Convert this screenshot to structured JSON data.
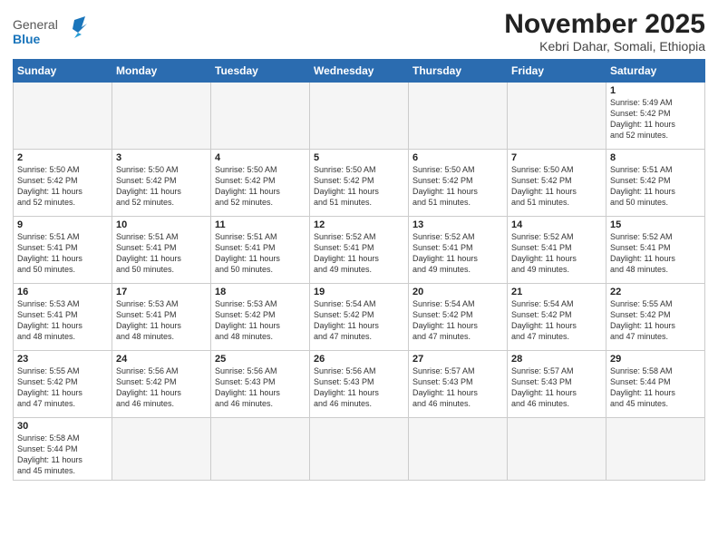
{
  "header": {
    "logo_line1": "General",
    "logo_line2": "Blue",
    "month": "November 2025",
    "location": "Kebri Dahar, Somali, Ethiopia"
  },
  "weekdays": [
    "Sunday",
    "Monday",
    "Tuesday",
    "Wednesday",
    "Thursday",
    "Friday",
    "Saturday"
  ],
  "weeks": [
    [
      {
        "day": "",
        "info": ""
      },
      {
        "day": "",
        "info": ""
      },
      {
        "day": "",
        "info": ""
      },
      {
        "day": "",
        "info": ""
      },
      {
        "day": "",
        "info": ""
      },
      {
        "day": "",
        "info": ""
      },
      {
        "day": "1",
        "info": "Sunrise: 5:49 AM\nSunset: 5:42 PM\nDaylight: 11 hours\nand 52 minutes."
      }
    ],
    [
      {
        "day": "2",
        "info": "Sunrise: 5:50 AM\nSunset: 5:42 PM\nDaylight: 11 hours\nand 52 minutes."
      },
      {
        "day": "3",
        "info": "Sunrise: 5:50 AM\nSunset: 5:42 PM\nDaylight: 11 hours\nand 52 minutes."
      },
      {
        "day": "4",
        "info": "Sunrise: 5:50 AM\nSunset: 5:42 PM\nDaylight: 11 hours\nand 52 minutes."
      },
      {
        "day": "5",
        "info": "Sunrise: 5:50 AM\nSunset: 5:42 PM\nDaylight: 11 hours\nand 51 minutes."
      },
      {
        "day": "6",
        "info": "Sunrise: 5:50 AM\nSunset: 5:42 PM\nDaylight: 11 hours\nand 51 minutes."
      },
      {
        "day": "7",
        "info": "Sunrise: 5:50 AM\nSunset: 5:42 PM\nDaylight: 11 hours\nand 51 minutes."
      },
      {
        "day": "8",
        "info": "Sunrise: 5:51 AM\nSunset: 5:42 PM\nDaylight: 11 hours\nand 50 minutes."
      }
    ],
    [
      {
        "day": "9",
        "info": "Sunrise: 5:51 AM\nSunset: 5:41 PM\nDaylight: 11 hours\nand 50 minutes."
      },
      {
        "day": "10",
        "info": "Sunrise: 5:51 AM\nSunset: 5:41 PM\nDaylight: 11 hours\nand 50 minutes."
      },
      {
        "day": "11",
        "info": "Sunrise: 5:51 AM\nSunset: 5:41 PM\nDaylight: 11 hours\nand 50 minutes."
      },
      {
        "day": "12",
        "info": "Sunrise: 5:52 AM\nSunset: 5:41 PM\nDaylight: 11 hours\nand 49 minutes."
      },
      {
        "day": "13",
        "info": "Sunrise: 5:52 AM\nSunset: 5:41 PM\nDaylight: 11 hours\nand 49 minutes."
      },
      {
        "day": "14",
        "info": "Sunrise: 5:52 AM\nSunset: 5:41 PM\nDaylight: 11 hours\nand 49 minutes."
      },
      {
        "day": "15",
        "info": "Sunrise: 5:52 AM\nSunset: 5:41 PM\nDaylight: 11 hours\nand 48 minutes."
      }
    ],
    [
      {
        "day": "16",
        "info": "Sunrise: 5:53 AM\nSunset: 5:41 PM\nDaylight: 11 hours\nand 48 minutes."
      },
      {
        "day": "17",
        "info": "Sunrise: 5:53 AM\nSunset: 5:41 PM\nDaylight: 11 hours\nand 48 minutes."
      },
      {
        "day": "18",
        "info": "Sunrise: 5:53 AM\nSunset: 5:42 PM\nDaylight: 11 hours\nand 48 minutes."
      },
      {
        "day": "19",
        "info": "Sunrise: 5:54 AM\nSunset: 5:42 PM\nDaylight: 11 hours\nand 47 minutes."
      },
      {
        "day": "20",
        "info": "Sunrise: 5:54 AM\nSunset: 5:42 PM\nDaylight: 11 hours\nand 47 minutes."
      },
      {
        "day": "21",
        "info": "Sunrise: 5:54 AM\nSunset: 5:42 PM\nDaylight: 11 hours\nand 47 minutes."
      },
      {
        "day": "22",
        "info": "Sunrise: 5:55 AM\nSunset: 5:42 PM\nDaylight: 11 hours\nand 47 minutes."
      }
    ],
    [
      {
        "day": "23",
        "info": "Sunrise: 5:55 AM\nSunset: 5:42 PM\nDaylight: 11 hours\nand 47 minutes."
      },
      {
        "day": "24",
        "info": "Sunrise: 5:56 AM\nSunset: 5:42 PM\nDaylight: 11 hours\nand 46 minutes."
      },
      {
        "day": "25",
        "info": "Sunrise: 5:56 AM\nSunset: 5:43 PM\nDaylight: 11 hours\nand 46 minutes."
      },
      {
        "day": "26",
        "info": "Sunrise: 5:56 AM\nSunset: 5:43 PM\nDaylight: 11 hours\nand 46 minutes."
      },
      {
        "day": "27",
        "info": "Sunrise: 5:57 AM\nSunset: 5:43 PM\nDaylight: 11 hours\nand 46 minutes."
      },
      {
        "day": "28",
        "info": "Sunrise: 5:57 AM\nSunset: 5:43 PM\nDaylight: 11 hours\nand 46 minutes."
      },
      {
        "day": "29",
        "info": "Sunrise: 5:58 AM\nSunset: 5:44 PM\nDaylight: 11 hours\nand 45 minutes."
      }
    ],
    [
      {
        "day": "30",
        "info": "Sunrise: 5:58 AM\nSunset: 5:44 PM\nDaylight: 11 hours\nand 45 minutes."
      },
      {
        "day": "",
        "info": ""
      },
      {
        "day": "",
        "info": ""
      },
      {
        "day": "",
        "info": ""
      },
      {
        "day": "",
        "info": ""
      },
      {
        "day": "",
        "info": ""
      },
      {
        "day": "",
        "info": ""
      }
    ]
  ]
}
